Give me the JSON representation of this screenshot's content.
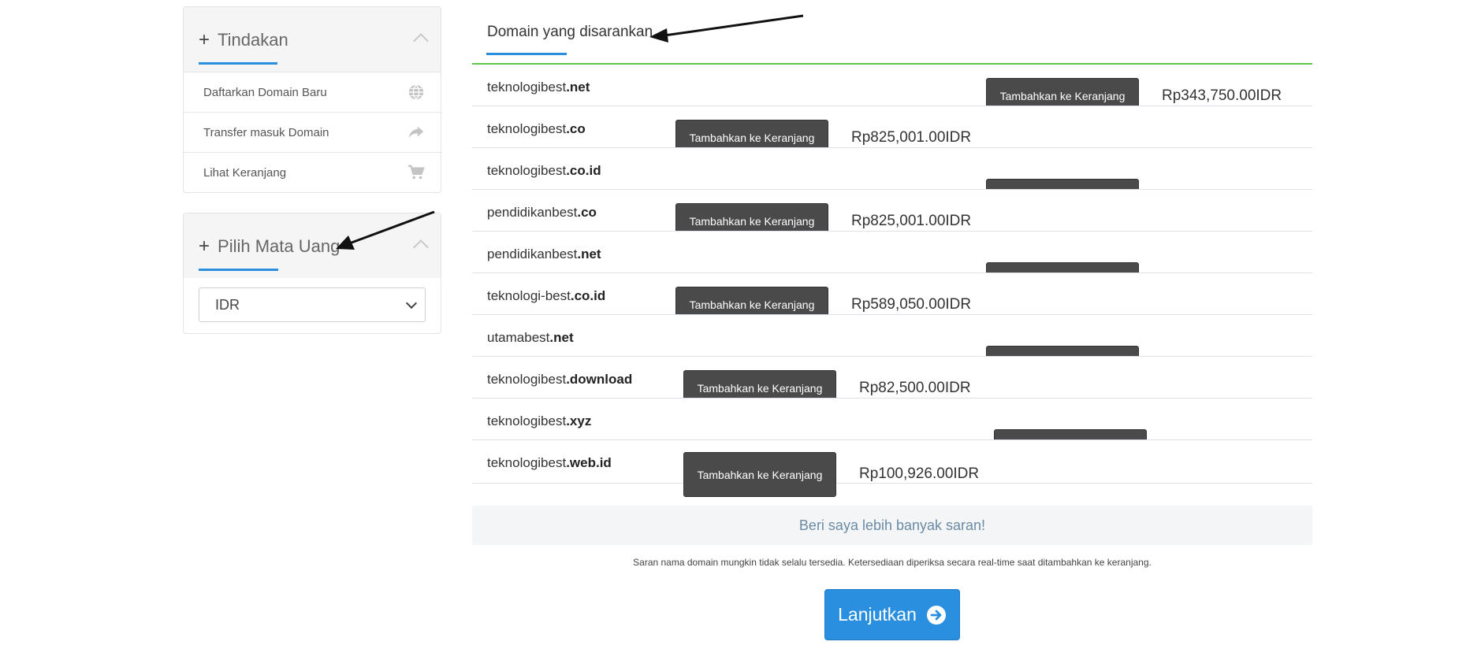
{
  "sidebar": {
    "actions": {
      "title": "Tindakan",
      "items": [
        {
          "label": "Daftarkan Domain Baru",
          "icon": "globe-icon"
        },
        {
          "label": "Transfer masuk Domain",
          "icon": "share-arrow-icon"
        },
        {
          "label": "Lihat Keranjang",
          "icon": "cart-icon"
        }
      ]
    },
    "currency": {
      "title": "Pilih Mata Uang",
      "selected": "IDR"
    }
  },
  "main": {
    "tab_title": "Domain yang disarankan",
    "add_label": "Tambahkan ke Keranjang",
    "rows": [
      {
        "name": "teknologibest",
        "tld": ".net",
        "price": "Rp343,750.00IDR"
      },
      {
        "name": "teknologibest",
        "tld": ".co",
        "price": "Rp825,001.00IDR"
      },
      {
        "name": "teknologibest",
        "tld": ".co.id",
        "price": ""
      },
      {
        "name": "pendidikanbest",
        "tld": ".co",
        "price": "Rp825,001.00IDR"
      },
      {
        "name": "pendidikanbest",
        "tld": ".net",
        "price": ""
      },
      {
        "name": "teknologi-best",
        "tld": ".co.id",
        "price": "Rp589,050.00IDR"
      },
      {
        "name": "utamabest",
        "tld": ".net",
        "price": ""
      },
      {
        "name": "teknologibest",
        "tld": ".download",
        "price": "Rp82,500.00IDR"
      },
      {
        "name": "teknologibest",
        "tld": ".xyz",
        "price": ""
      },
      {
        "name": "teknologibest",
        "tld": ".web.id",
        "price": "Rp100,926.00IDR"
      }
    ],
    "more_label": "Beri saya lebih banyak saran!",
    "disclaimer": "Saran nama domain mungkin tidak selalu tersedia. Ketersediaan diperiksa secara real-time saat ditambahkan ke keranjang.",
    "continue_label": "Lanjutkan"
  }
}
